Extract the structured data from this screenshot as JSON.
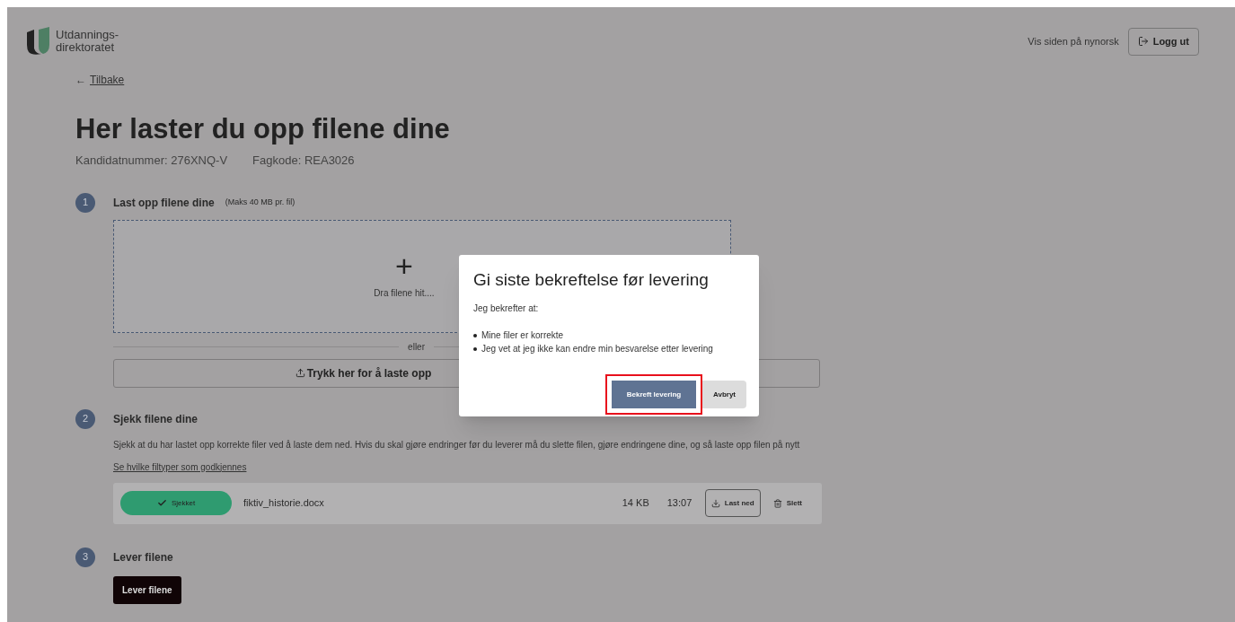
{
  "header": {
    "logo_text": [
      "Utdannings-",
      "direktoratet"
    ],
    "language_link": "Vis siden på nynorsk",
    "logout_button": "Logg ut"
  },
  "back_link": {
    "arrow": "←",
    "label": "Tilbake"
  },
  "title": "Her laster du opp filene dine",
  "meta": [
    "Kandidatnummer: 276XNQ-V",
    "Fagkode: REA3026"
  ],
  "steps": [
    {
      "number": "1",
      "title": "Last opp filene dine",
      "note": "(Maks 40 MB pr. fil)",
      "dropzone": {
        "icon": "+",
        "text": "Dra filene hit...."
      },
      "divider": "eller",
      "upload_button": "Trykk her for å laste opp"
    },
    {
      "number": "2",
      "title": "Sjekk filene dine",
      "text": "Sjekk at du har lastet opp korrekte filer ved å laste dem ned. Hvis du skal gjøre endringer før du leverer må du slette filen, gjøre endringene dine, og så laste opp filen på nytt",
      "link": "Se hvilke filtyper som godkjennes",
      "files": [
        {
          "status": "Sjekket",
          "name": "fiktiv_historie.docx",
          "size": "14 KB",
          "time": "13:07",
          "download": "Last ned",
          "delete": "Slett"
        }
      ]
    },
    {
      "number": "3",
      "title": "Lever filene",
      "button": "Lever filene"
    }
  ],
  "dialog": {
    "title": "Gi siste bekreftelse før levering",
    "intro": "Jeg bekrefter at:",
    "bullets": [
      "Mine filer er korrekte",
      "Jeg vet at jeg ikke kan endre min besvarelse etter levering"
    ],
    "confirm_button": "Bekreft levering",
    "confirm_highlighted": true,
    "cancel_button": "Avbryt"
  }
}
